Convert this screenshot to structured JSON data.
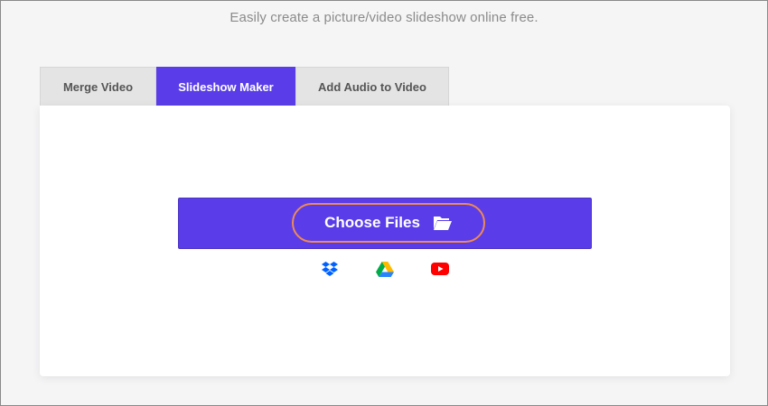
{
  "header": {
    "subtitle": "Easily create a picture/video slideshow online free."
  },
  "tabs": [
    {
      "label": "Merge Video",
      "active": false
    },
    {
      "label": "Slideshow Maker",
      "active": true
    },
    {
      "label": "Add Audio to Video",
      "active": false
    }
  ],
  "upload": {
    "choose_label": "Choose Files",
    "icons": [
      "folder-open-icon",
      "dropbox-icon",
      "google-drive-icon",
      "youtube-icon"
    ]
  },
  "colors": {
    "accent": "#5a3de8",
    "highlight_ring": "#f08a53",
    "dropbox": "#0061fe",
    "youtube": "#ff0000"
  }
}
